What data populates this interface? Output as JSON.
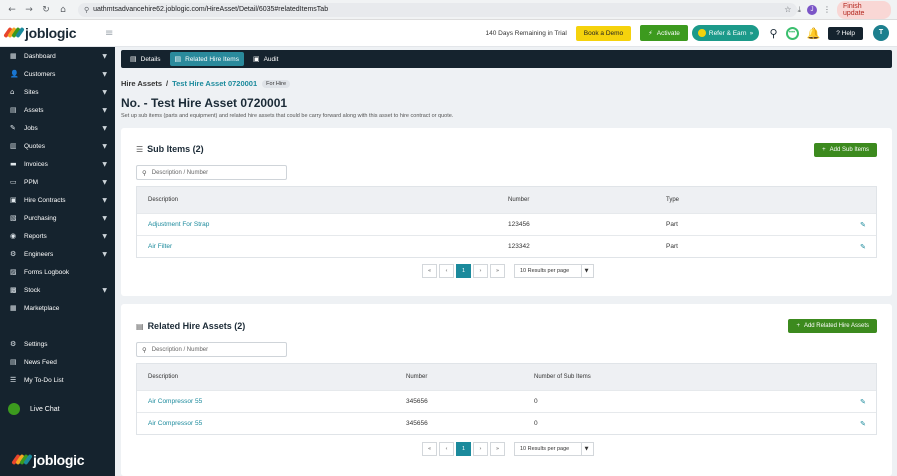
{
  "browser": {
    "url": "uathmtsadvancehire62.joblogic.com/HireAsset/Detail/6035#relatedItemsTab",
    "profile_initial": "J",
    "finish_update": "Finish update"
  },
  "header": {
    "logo_text": "joblogic",
    "trial_text": "140 Days Remaining in Trial",
    "book_demo": "Book a Demo",
    "activate": "Activate",
    "refer_earn": "Refer & Earn",
    "help": "Help",
    "user_initial": "T"
  },
  "sidebar": {
    "items": [
      {
        "label": "Dashboard",
        "icon": "▦",
        "chev": true
      },
      {
        "label": "Customers",
        "icon": "👤",
        "chev": true
      },
      {
        "label": "Sites",
        "icon": "⌂",
        "chev": true
      },
      {
        "label": "Assets",
        "icon": "▤",
        "chev": true
      },
      {
        "label": "Jobs",
        "icon": "✎",
        "chev": true
      },
      {
        "label": "Quotes",
        "icon": "▥",
        "chev": true
      },
      {
        "label": "Invoices",
        "icon": "▬",
        "chev": true
      },
      {
        "label": "PPM",
        "icon": "▭",
        "chev": true
      },
      {
        "label": "Hire Contracts",
        "icon": "▣",
        "chev": true
      },
      {
        "label": "Purchasing",
        "icon": "▧",
        "chev": true
      },
      {
        "label": "Reports",
        "icon": "◉",
        "chev": true
      },
      {
        "label": "Engineers",
        "icon": "⚙",
        "chev": true
      },
      {
        "label": "Forms Logbook",
        "icon": "▨",
        "chev": false
      },
      {
        "label": "Stock",
        "icon": "▩",
        "chev": true
      },
      {
        "label": "Marketplace",
        "icon": "▦",
        "chev": false
      }
    ],
    "bottom_items": [
      {
        "label": "Settings",
        "icon": "⚙"
      },
      {
        "label": "News Feed",
        "icon": "▤"
      },
      {
        "label": "My To-Do List",
        "icon": "☰"
      }
    ],
    "live_chat": "Live Chat",
    "logo_text": "joblogic"
  },
  "tabs": [
    {
      "label": "Details",
      "active": false
    },
    {
      "label": "Related Hire Items",
      "active": true
    },
    {
      "label": "Audit",
      "active": false
    }
  ],
  "breadcrumb": {
    "root": "Hire Assets",
    "current": "Test Hire Asset 0720001",
    "badge": "For Hire"
  },
  "page": {
    "title": "No. - Test Hire Asset 0720001",
    "subtitle": "Set up sub items (parts and equipment) and related hire assets that could be carry forward along with this asset to hire contract or quote."
  },
  "sub_items": {
    "title": "Sub Items (2)",
    "add_label": "Add Sub Items",
    "search_placeholder": "Description / Number",
    "columns": [
      "Description",
      "Number",
      "Type"
    ],
    "rows": [
      {
        "description": "Adjustment For Strap",
        "number": "123456",
        "type": "Part"
      },
      {
        "description": "Air Filter",
        "number": "123342",
        "type": "Part"
      }
    ],
    "page": "1",
    "per_page": "10 Results per page"
  },
  "related": {
    "title": "Related Hire Assets (2)",
    "add_label": "Add Related Hire Assets",
    "search_placeholder": "Description / Number",
    "columns": [
      "Description",
      "Number",
      "Number of Sub Items"
    ],
    "rows": [
      {
        "description": "Air Compressor 55",
        "number": "345656",
        "subitems": "0"
      },
      {
        "description": "Air Compressor 55",
        "number": "345656",
        "subitems": "0"
      }
    ],
    "page": "1",
    "per_page": "10 Results per page"
  },
  "colors": {
    "sidebar_bg": "#15232e",
    "accent_teal": "#1b8a9c",
    "add_green": "#3c8a1e",
    "demo_yellow": "#f5d20c"
  }
}
